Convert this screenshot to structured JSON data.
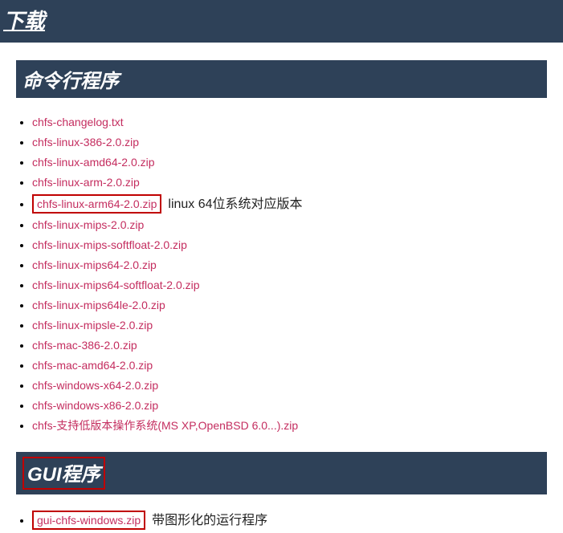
{
  "page": {
    "title": "下载"
  },
  "sections": {
    "cli": {
      "title": "命令行程序",
      "items": [
        {
          "label": "chfs-changelog.txt"
        },
        {
          "label": "chfs-linux-386-2.0.zip"
        },
        {
          "label": "chfs-linux-amd64-2.0.zip"
        },
        {
          "label": "chfs-linux-arm-2.0.zip"
        },
        {
          "label": "chfs-linux-arm64-2.0.zip",
          "boxed": true,
          "annotation": "linux 64位系统对应版本"
        },
        {
          "label": "chfs-linux-mips-2.0.zip"
        },
        {
          "label": "chfs-linux-mips-softfloat-2.0.zip"
        },
        {
          "label": "chfs-linux-mips64-2.0.zip"
        },
        {
          "label": "chfs-linux-mips64-softfloat-2.0.zip"
        },
        {
          "label": "chfs-linux-mips64le-2.0.zip"
        },
        {
          "label": "chfs-linux-mipsle-2.0.zip"
        },
        {
          "label": "chfs-mac-386-2.0.zip"
        },
        {
          "label": "chfs-mac-amd64-2.0.zip"
        },
        {
          "label": "chfs-windows-x64-2.0.zip"
        },
        {
          "label": "chfs-windows-x86-2.0.zip"
        },
        {
          "label": "chfs-支持低版本操作系统(MS XP,OpenBSD 6.0...).zip"
        }
      ]
    },
    "gui": {
      "title": "GUI程序",
      "boxed": true,
      "items": [
        {
          "label": "gui-chfs-windows.zip",
          "boxed": true,
          "annotation": "带图形化的运行程序"
        }
      ]
    }
  }
}
